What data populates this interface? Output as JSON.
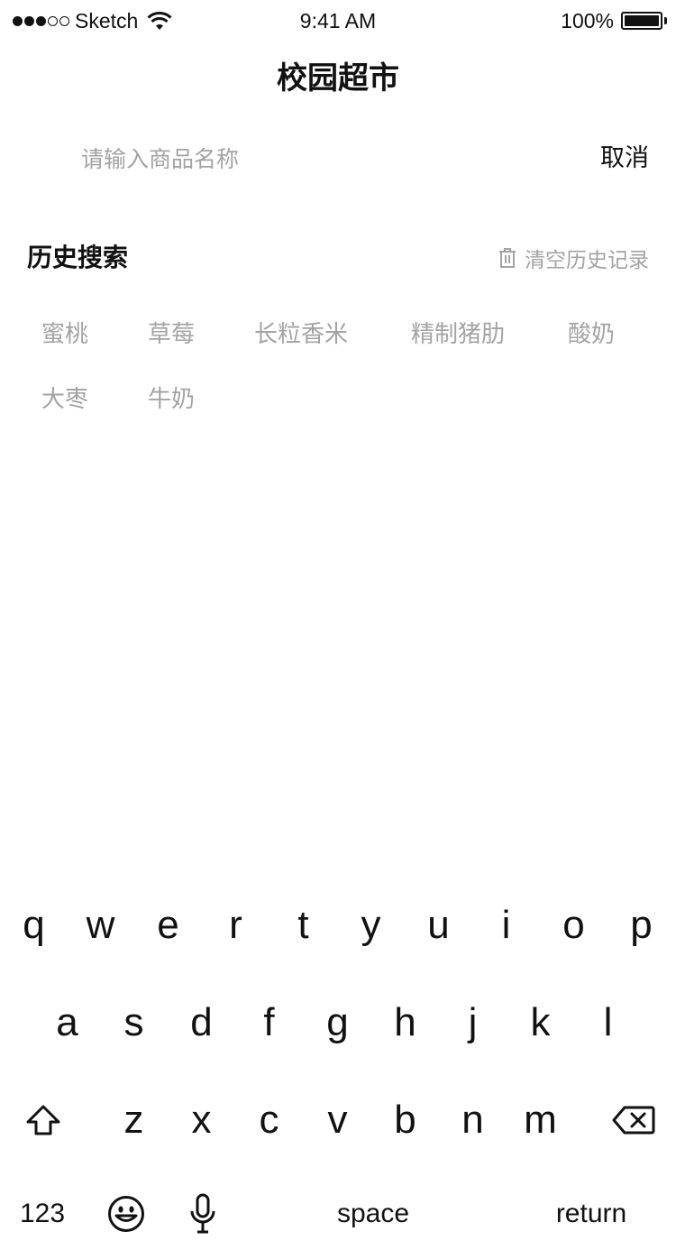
{
  "status_bar": {
    "carrier": "Sketch",
    "time": "9:41 AM",
    "battery": "100%"
  },
  "nav": {
    "title": "校园超市"
  },
  "search": {
    "placeholder": "请输入商品名称",
    "value": "",
    "cancel_label": "取消"
  },
  "history": {
    "title": "历史搜索",
    "clear_label": "清空历史记录",
    "tags": [
      "蜜桃",
      "草莓",
      "长粒香米",
      "精制猪肋",
      "酸奶",
      "大枣",
      "牛奶"
    ]
  },
  "keyboard": {
    "row1": [
      "q",
      "w",
      "e",
      "r",
      "t",
      "y",
      "u",
      "i",
      "o",
      "p"
    ],
    "row2": [
      "a",
      "s",
      "d",
      "f",
      "g",
      "h",
      "j",
      "k",
      "l"
    ],
    "row3": [
      "z",
      "x",
      "c",
      "v",
      "b",
      "n",
      "m"
    ],
    "numbers_label": "123",
    "space_label": "space",
    "return_label": "return"
  },
  "icons": {
    "signal": "signal-dots-icon",
    "wifi": "wifi-icon",
    "battery": "battery-icon",
    "trash": "trash-icon",
    "shift": "shift-icon",
    "delete": "delete-icon",
    "emoji": "emoji-icon",
    "mic": "microphone-icon"
  }
}
